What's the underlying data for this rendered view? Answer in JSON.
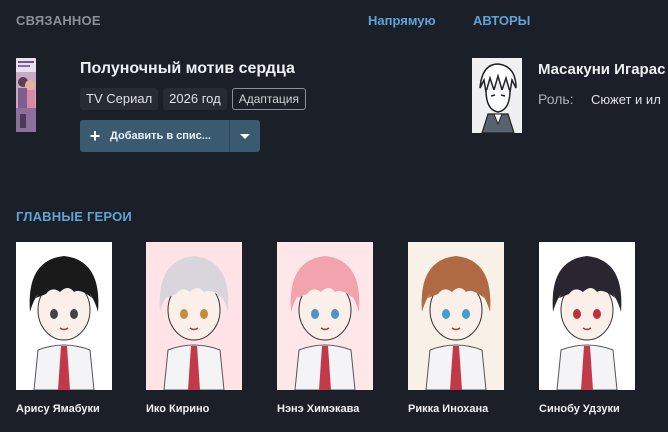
{
  "related": {
    "title": "СВЯЗАННОЕ",
    "tabs": [
      "Напрямую",
      "АВТОРЫ"
    ],
    "work": {
      "title": "Полуночный мотив сердца",
      "tags": [
        "TV Сериал",
        "2026 год"
      ],
      "relation": "Адаптация",
      "add_button": "Добавить в спис..."
    },
    "author": {
      "name": "Масакуни Игарас",
      "role_label": "Роль:",
      "role_value": "Сюжет и ил"
    }
  },
  "heroes": {
    "title": "ГЛАВНЫЕ ГЕРОИ",
    "items": [
      {
        "name": "Арису Ямабуки",
        "hair": "#1a1a1a",
        "eyes": "#444444",
        "bg": "#ffffff"
      },
      {
        "name": "Ико Кирино",
        "hair": "#d8d6dc",
        "eyes": "#c98a3c",
        "bg": "#ffe3e6"
      },
      {
        "name": "Нэнэ Химэкава",
        "hair": "#f2a3ae",
        "eyes": "#4e93c4",
        "bg": "#ffe6e9"
      },
      {
        "name": "Рикка Инохана",
        "hair": "#b06a43",
        "eyes": "#3f9fd0",
        "bg": "#f8f1e8"
      },
      {
        "name": "Синобу Удзуки",
        "hair": "#2a2630",
        "eyes": "#c0303a",
        "bg": "#ffffff"
      }
    ]
  },
  "colors": {
    "background": "#1b1f27",
    "accent": "#5fa3d8",
    "button": "#3a5a70"
  },
  "icons": {
    "add": "plus-icon",
    "dropdown": "caret-down-icon"
  }
}
